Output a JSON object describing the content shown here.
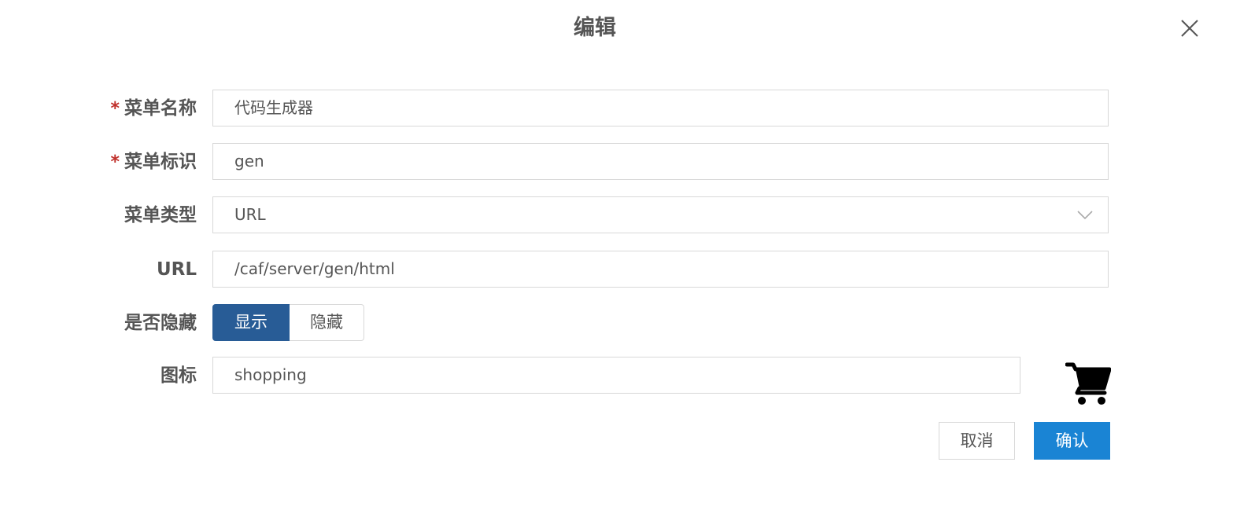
{
  "dialog": {
    "title": "编辑"
  },
  "form": {
    "menu_name": {
      "required_mark": "*",
      "label": "菜单名称",
      "value": "代码生成器"
    },
    "menu_key": {
      "required_mark": "*",
      "label": "菜单标识",
      "value": "gen"
    },
    "menu_type": {
      "label": "菜单类型",
      "value": "URL"
    },
    "url": {
      "label": "URL",
      "value": "/caf/server/gen/html"
    },
    "hidden": {
      "label": "是否隐藏",
      "show_label": "显示",
      "hide_label": "隐藏",
      "selected": "显示"
    },
    "icon": {
      "label": "图标",
      "value": "shopping",
      "preview_icon": "shopping-cart-icon"
    }
  },
  "buttons": {
    "cancel_label": "取消",
    "confirm_label": "确认"
  },
  "colors": {
    "primary": "#1a84d4",
    "toggle_active": "#285c96",
    "required": "#c0302b"
  }
}
